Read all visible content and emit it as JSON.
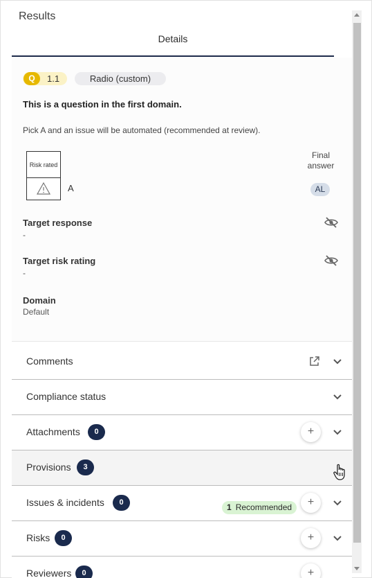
{
  "header": {
    "title": "Results",
    "tab_label": "Details"
  },
  "question": {
    "badge_letter": "Q",
    "number": "1.1",
    "type": "Radio (custom)",
    "text": "This is a question in the first domain.",
    "instruction": "Pick A and an issue will be automated (recommended at review).",
    "risk_label": "Risk rated",
    "option": "A",
    "final_answer_label": "Final answer",
    "final_answer_value": "AL"
  },
  "fields": {
    "target_response": {
      "label": "Target response",
      "value": "-"
    },
    "target_risk_rating": {
      "label": "Target risk rating",
      "value": "-"
    },
    "domain": {
      "label": "Domain",
      "value": "Default"
    }
  },
  "accordion": {
    "comments": {
      "label": "Comments"
    },
    "compliance": {
      "label": "Compliance status"
    },
    "attachments": {
      "label": "Attachments",
      "count": "0"
    },
    "provisions": {
      "label": "Provisions",
      "count": "3"
    },
    "issues": {
      "label": "Issues & incidents",
      "count": "0",
      "recommended_count": "1",
      "recommended_label": "Recommended"
    },
    "risks": {
      "label": "Risks",
      "count": "0"
    },
    "reviewers": {
      "label": "Reviewers",
      "count": "0"
    }
  },
  "colors": {
    "accent_navy": "#1a2a4d",
    "q_badge": "#e6b800",
    "recommended_bg": "#d9f3d3"
  }
}
